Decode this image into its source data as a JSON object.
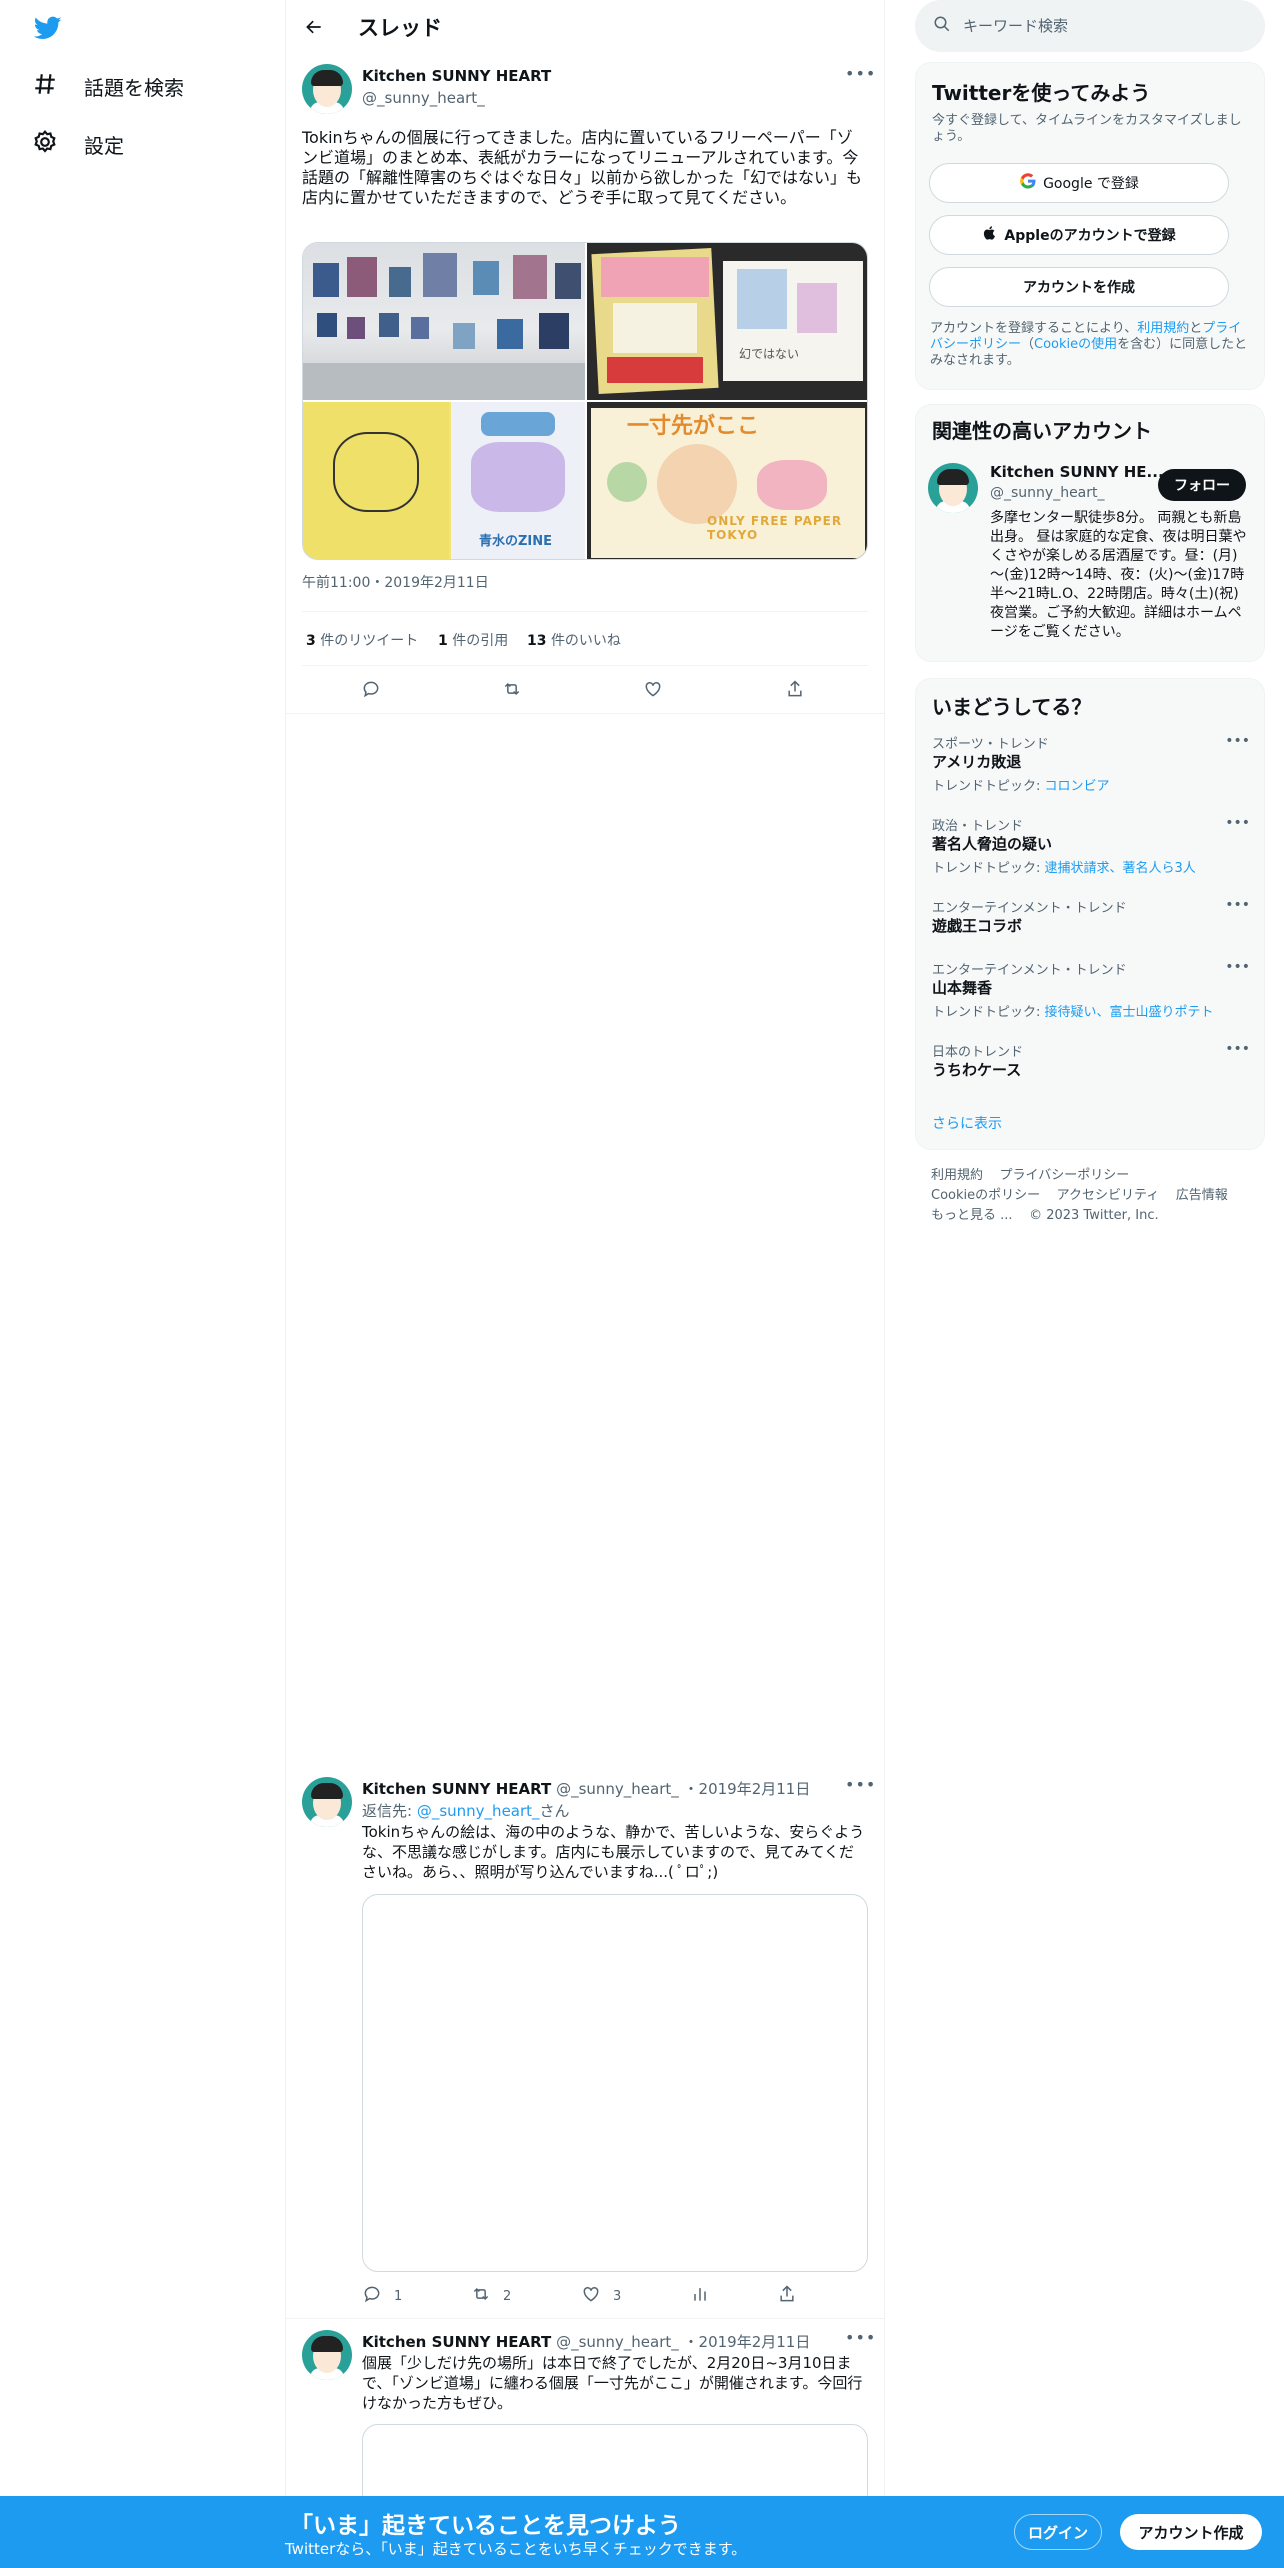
{
  "nav": {
    "explore_label": "話題を検索",
    "settings_label": "設定"
  },
  "header": {
    "title": "スレッド"
  },
  "main_tweet": {
    "name": "Kitchen SUNNY HEART",
    "handle": "@_sunny_heart_",
    "text": "Tokinちゃんの個展に行ってきました。店内に置いているフリーペーパー「ゾンビ道場」のまとめ本、表紙がカラーになってリニューアルされています。今話題の「解離性障害のちぐはぐな日々」以前から欲しかった「幻ではない」も店内に置かせていただきますので、どうぞ手に取って見てください。",
    "timestamp": "午前11:00・2019年2月11日",
    "photos": [
      {
        "caption": ""
      },
      {
        "caption": "幻ではない"
      },
      {
        "caption": "青水のZINE"
      },
      {
        "caption": "一寸先がここ",
        "sub": "ONLY FREE PAPER TOKYO"
      }
    ],
    "retweets": "3",
    "retweets_label": "件のリツイート",
    "quotes": "1",
    "quotes_label": "件の引用",
    "likes": "13",
    "likes_label": "件のいいね"
  },
  "reply1": {
    "name": "Kitchen SUNNY HEART",
    "handle": "@_sunny_heart_",
    "date": "・2019年2月11日",
    "reply_to_label": "返信先:",
    "reply_to_handle": "@_sunny_heart_",
    "reply_to_suffix": "さん",
    "text": "Tokinちゃんの絵は、海の中のような、静かで、苦しいような、安らぐような、不思議な感じがします。店内にも展示していますので、見てみてくださいね。あら、、照明が写り込んでいますね...( ﾟロﾟ;)",
    "replies": "1",
    "retweets": "2",
    "likes": "3"
  },
  "reply2": {
    "name": "Kitchen SUNNY HEART",
    "handle": "@_sunny_heart_",
    "date": "・2019年2月11日",
    "text": "個展「少しだけ先の場所」は本日で終了でしたが、2月20日~3月10日まで、「ゾンビ道場」に纏わる個展「一寸先がここ」が開催されます。今回行けなかった方もぜひ。"
  },
  "sidebar": {
    "search_placeholder": "キーワード検索",
    "signup": {
      "title": "Twitterを使ってみよう",
      "desc": "今すぐ登録して、タイムラインをカスタマイズしましょう。",
      "google_label": "Google で登録",
      "apple_label": "Appleのアカウントで登録",
      "create_label": "アカウントを作成",
      "terms_pre": "アカウントを登録することにより、",
      "terms_link": "利用規約",
      "terms_mid": "と",
      "privacy_link": "プライバシーポリシー",
      "cookie_pre": "（",
      "cookie_link": "Cookieの使用",
      "terms_post": "を含む）に同意したとみなされます。"
    },
    "related": {
      "title": "関連性の高いアカウント",
      "name": "Kitchen SUNNY HE...",
      "handle": "@_sunny_heart_",
      "follow_label": "フォロー",
      "bio": "多摩センター駅徒歩8分。 両親とも新島出身。 昼は家庭的な定食、夜は明日葉やくさやが楽しめる居酒屋です。昼：(月)～(金)12時～14時、夜：(火)～(金)17時半～21時L.O、22時閉店。時々(土)(祝)夜営業。ご予約大歓迎。詳細はホームページをご覧ください。"
    },
    "trends": {
      "title": "いまどうしてる？",
      "items": [
        {
          "meta": "スポーツ・トレンド",
          "name": "アメリカ敗退",
          "topic_label": "トレンドトピック: ",
          "topic": "コロンビア"
        },
        {
          "meta": "政治・トレンド",
          "name": "著名人脅迫の疑い",
          "topic_label": "トレンドトピック: ",
          "topic": "逮捕状請求、著名人ら3人"
        },
        {
          "meta": "エンターテインメント・トレンド",
          "name": "遊戯王コラボ",
          "topic_label": "",
          "topic": ""
        },
        {
          "meta": "エンターテインメント・トレンド",
          "name": "山本舞香",
          "topic_label": "トレンドトピック: ",
          "topic": "接待疑い、富士山盛りポテト"
        },
        {
          "meta": "日本のトレンド",
          "name": "うちわケース",
          "topic_label": "",
          "topic": ""
        }
      ],
      "show_more": "さらに表示"
    },
    "footer": {
      "terms": "利用規約",
      "privacy": "プライバシーポリシー",
      "cookie": "Cookieのポリシー",
      "accessibility": "アクセシビリティ",
      "ads": "広告情報",
      "more": "もっと見る ...",
      "copyright": "© 2023 Twitter, Inc."
    }
  },
  "bottom_bar": {
    "title": "「いま」起きていることを見つけよう",
    "subtitle": "Twitterなら、「いま」起きていることをいち早くチェックできます。",
    "login_label": "ログイン",
    "signup_label": "アカウント作成"
  },
  "colors": {
    "accent": "#1d9bf0",
    "text": "#0f1419",
    "secondary": "#536471"
  }
}
